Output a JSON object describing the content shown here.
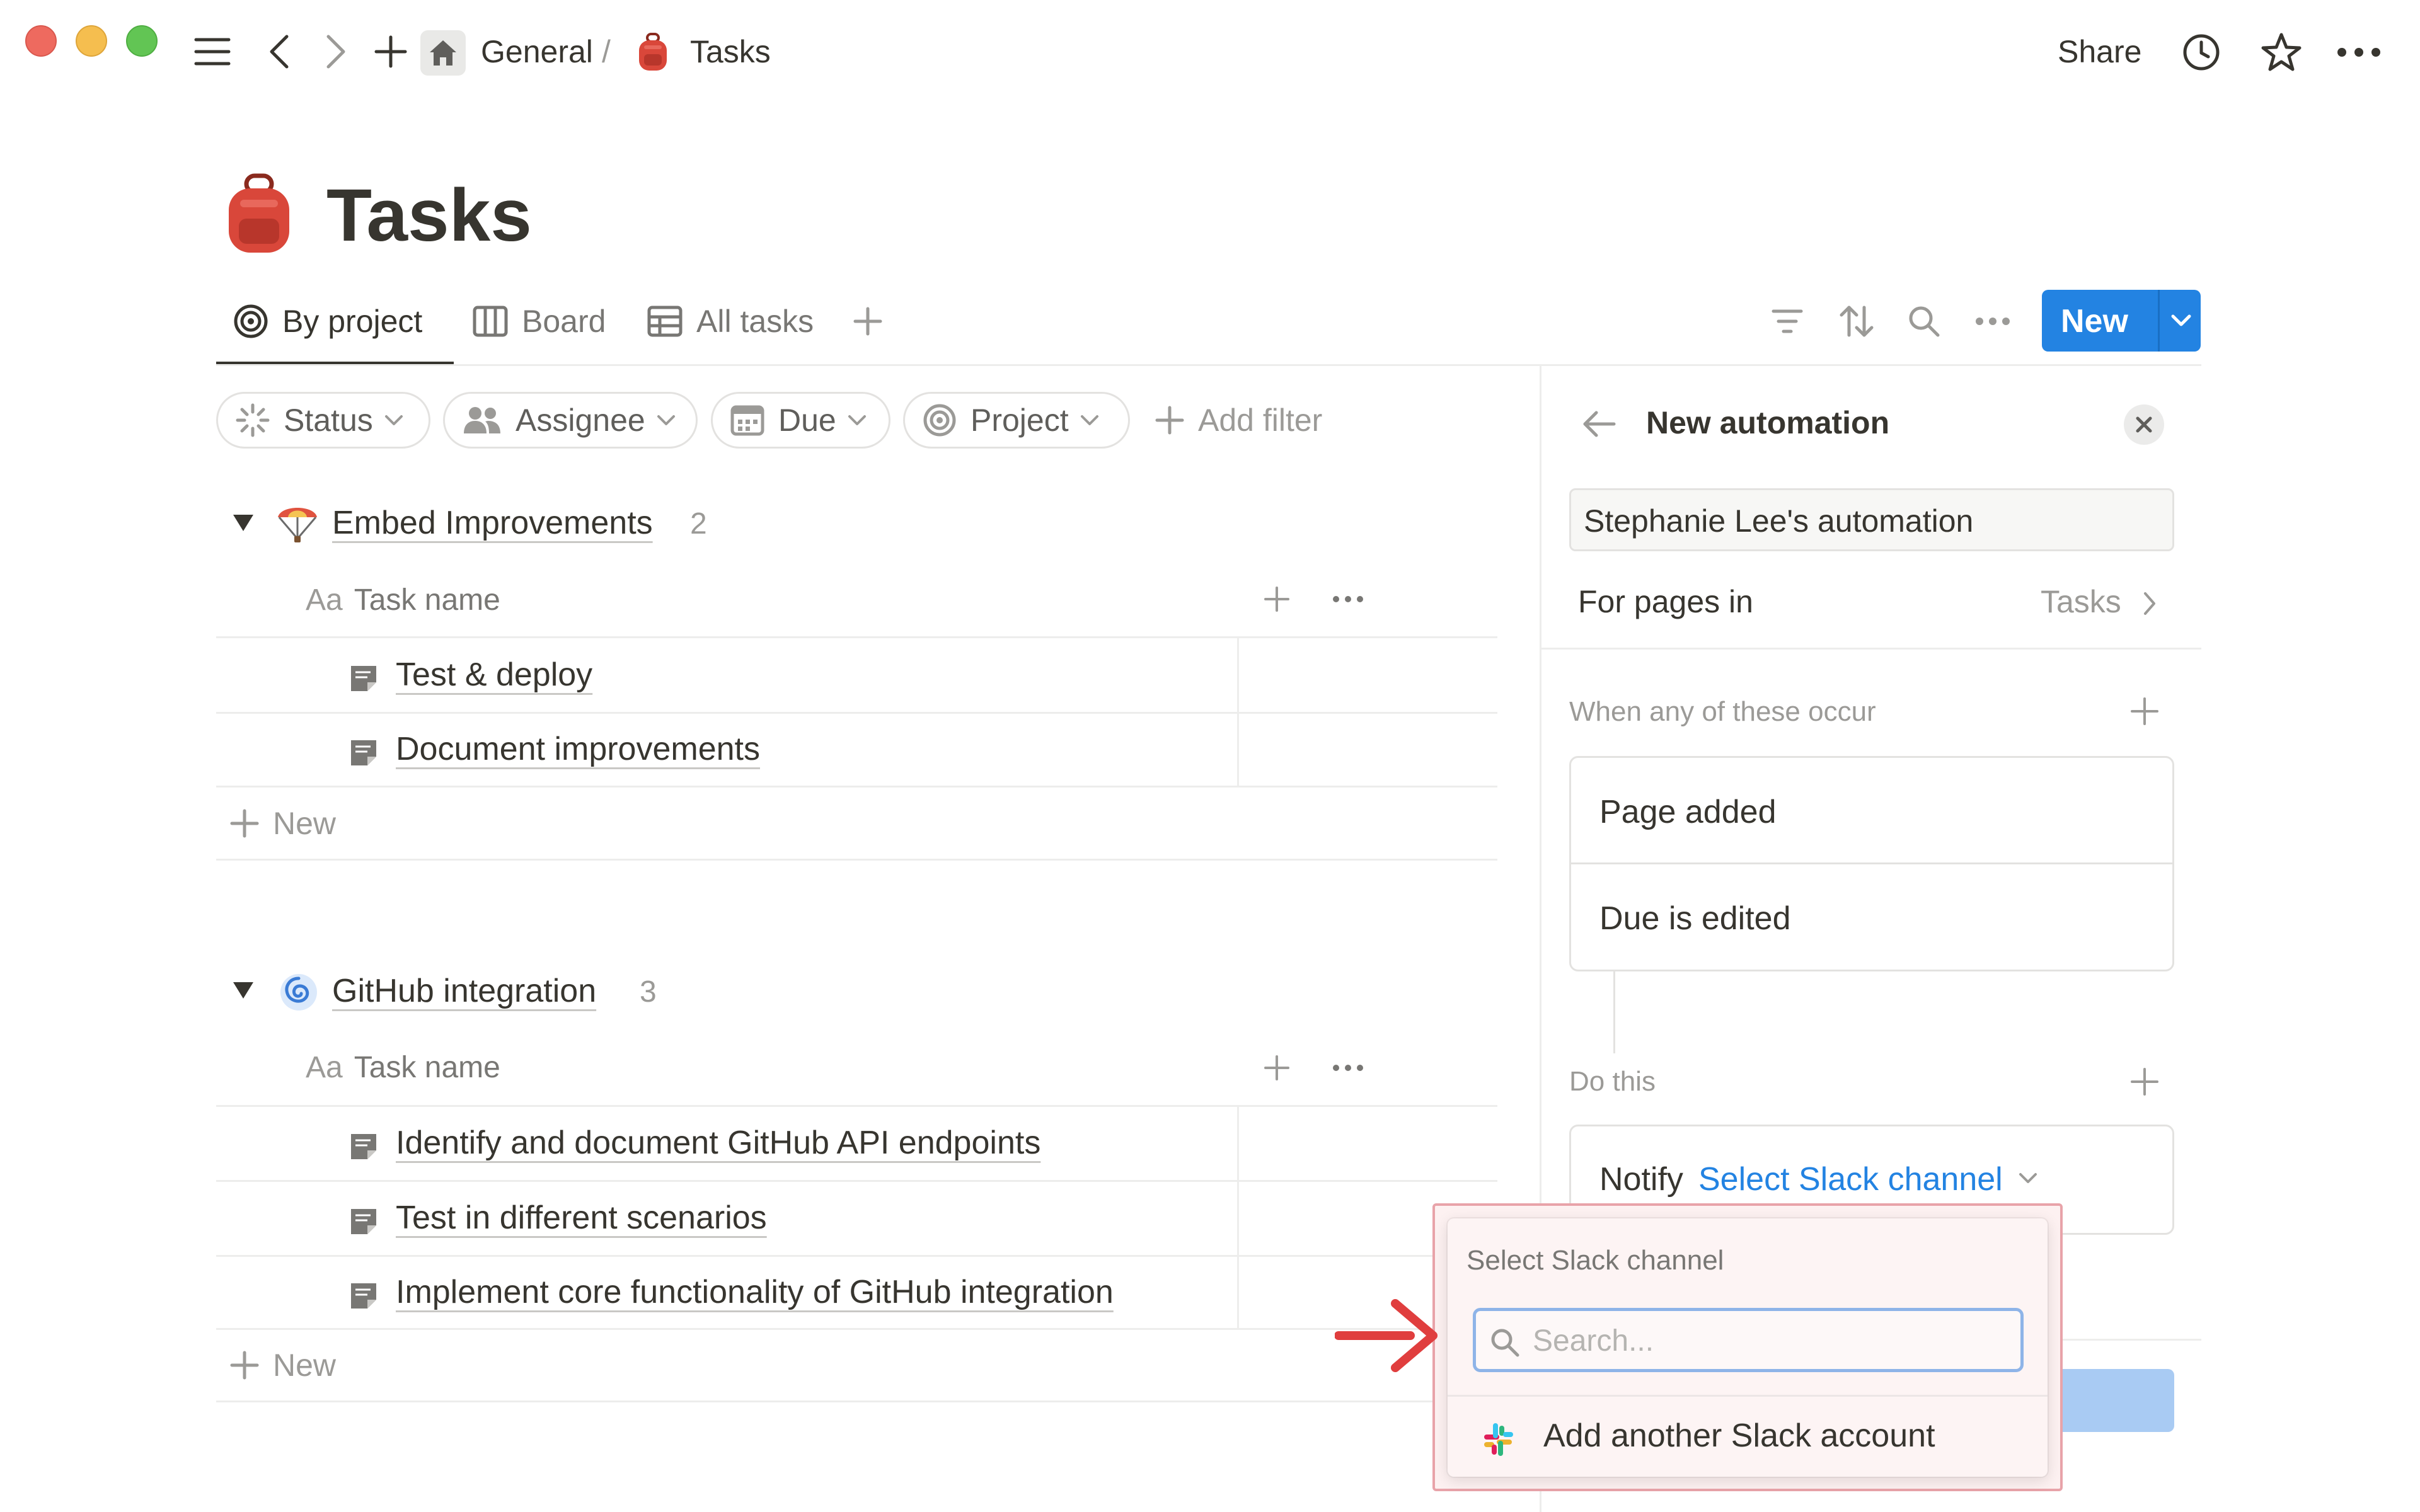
{
  "topbar": {
    "breadcrumb_workspace": "General",
    "breadcrumb_sep": "/",
    "breadcrumb_page": "Tasks",
    "share_label": "Share"
  },
  "page": {
    "title": "Tasks"
  },
  "views": {
    "tabs": [
      "By project",
      "Board",
      "All tasks"
    ],
    "new_button": "New"
  },
  "filters": {
    "chips": [
      "Status",
      "Assignee",
      "Due",
      "Project"
    ],
    "add_filter": "Add filter"
  },
  "groups": [
    {
      "title": "Embed Improvements",
      "count": "2",
      "column_prefix": "Aa",
      "column_header": "Task name",
      "tasks": [
        "Test & deploy",
        "Document improvements"
      ],
      "new_label": "New"
    },
    {
      "title": "GitHub integration",
      "count": "3",
      "column_prefix": "Aa",
      "column_header": "Task name",
      "tasks": [
        "Identify and document GitHub API endpoints",
        "Test in different scenarios",
        "Implement core functionality of GitHub integration"
      ],
      "new_label": "New"
    }
  ],
  "automation": {
    "title": "New automation",
    "name_value": "Stephanie Lee's automation",
    "for_pages_label": "For pages in",
    "for_pages_value": "Tasks",
    "triggers_label": "When any of these occur",
    "triggers": [
      "Page added",
      "Due is edited"
    ],
    "actions_label": "Do this",
    "notify_label": "Notify",
    "notify_target": "Select Slack channel"
  },
  "slack_dropdown": {
    "header": "Select Slack channel",
    "search_placeholder": "Search...",
    "add_account": "Add another Slack account"
  },
  "colors": {
    "accent": "#2383e2",
    "highlight_border": "#e8a3a9",
    "highlight_fill": "#fdf1f1",
    "arrow": "#e03e3e"
  }
}
